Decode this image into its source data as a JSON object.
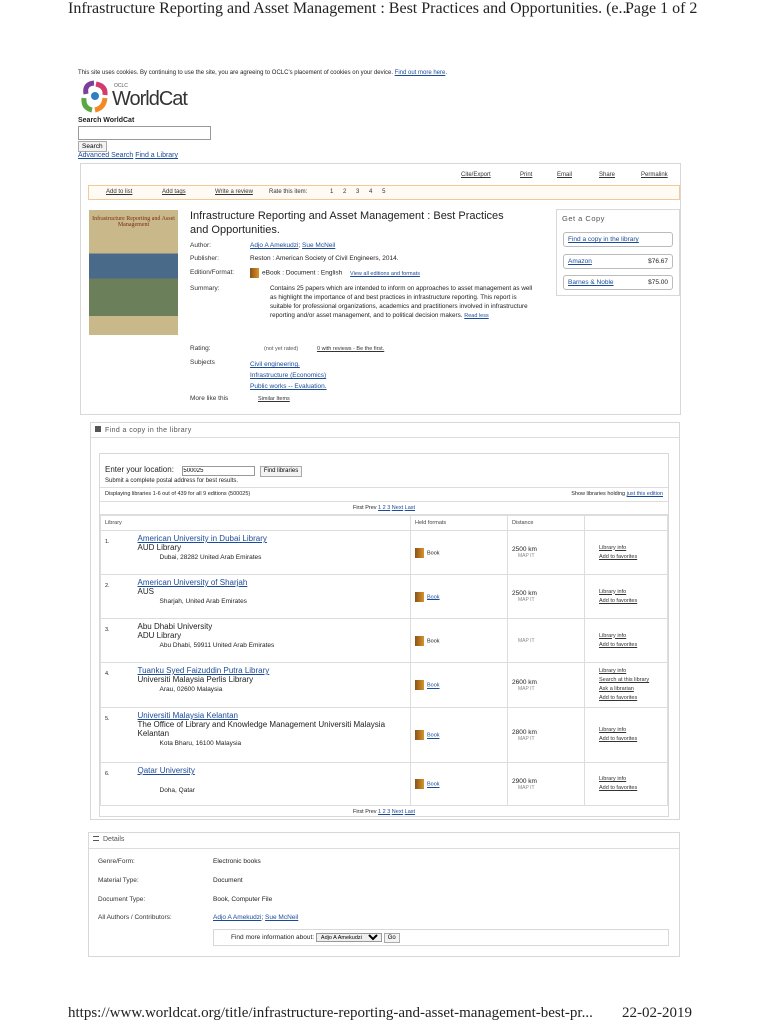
{
  "print_header": {
    "title": "Infrastructure Reporting and Asset Management : Best Practices and Opportunities. (e...",
    "page": "Page 1 of 2"
  },
  "cookie": {
    "text": "This site uses cookies. By continuing to use the site, you are agreeing to OCLC's placement of cookies on your device.",
    "link": "Find out more here",
    "end": "."
  },
  "logo": {
    "brand": "WorldCat",
    "sub": "OCLC"
  },
  "search": {
    "label": "Search WorldCat",
    "value": "",
    "button": "Search",
    "advanced": "Advanced Search",
    "find_library": "Find a Library"
  },
  "toolbar": {
    "cite": "Cite/Export",
    "print": "Print",
    "email": "Email",
    "share": "Share",
    "permalink": "Permalink"
  },
  "actions": {
    "add_list": "Add to list",
    "add_tags": "Add tags",
    "review": "Write a review",
    "rate": "Rate this item:",
    "ratings": [
      "1",
      "2",
      "3",
      "4",
      "5"
    ]
  },
  "record": {
    "cover_title": "Infrastructure Reporting and Asset Management",
    "title": "Infrastructure Reporting and Asset Management : Best Practices and Opportunities.",
    "author_label": "Author:",
    "authors": [
      "Adjo A Amekudzi",
      "Sue McNeil"
    ],
    "publisher_label": "Publisher:",
    "publisher": "Reston : American Society of Civil Engineers, 2014.",
    "edition_label": "Edition/Format:",
    "edition": "eBook : Document : English",
    "view_editions": "View all editions and formats",
    "summary_label": "Summary:",
    "summary": "Contains 25 papers which are intended to inform on approaches to asset management as well as highlight the importance of and best practices in infrastructure reporting. This report is suitable for professional organizations, academics and practitioners involved in infrastructure reporting and/or asset management, and to political decision makers.",
    "read_less": "Read less",
    "rating_label": "Rating:",
    "rating": "(not yet rated)",
    "reviews": "0 with reviews - Be the first.",
    "subjects_label": "Subjects",
    "subjects": [
      "Civil engineering.",
      "Infrastructure (Economics)",
      "Public works -- Evaluation."
    ],
    "more_label": "More like this",
    "similar": "Similar Items"
  },
  "get_copy": {
    "title": "Get a Copy",
    "find": "Find a copy in the library",
    "sellers": [
      {
        "name": "Amazon",
        "price": "$76.67"
      },
      {
        "name": "Barnes & Noble",
        "price": "$75.00"
      }
    ]
  },
  "find_copy": {
    "title": "Find a copy in the library",
    "location_label": "Enter your location:",
    "location": "500025",
    "find_btn": "Find libraries",
    "hint": "Submit a complete postal address for best results.",
    "displaying": "Displaying libraries 1-6 out of 439 for all 9 editions (500025)",
    "show_holding": "Show libraries holding",
    "just_edition": "just this edition",
    "pager": {
      "first": "First",
      "prev": "Prev",
      "pages": "1 2 3",
      "next": "Next",
      "last": "Last"
    },
    "columns": [
      "Library",
      "Held formats",
      "Distance",
      ""
    ],
    "rows": [
      {
        "n": "1.",
        "name": "American University in Dubai Library",
        "linked": true,
        "sub": "AUD Library",
        "addr": "Dubai, 28282 United Arab Emirates",
        "format": "Book",
        "dist": "2500 km",
        "map": "MAP IT",
        "acts": [
          "Library info",
          "Add to favorites"
        ]
      },
      {
        "n": "2.",
        "name": "American University of Sharjah",
        "linked": true,
        "sub": "AUS",
        "addr": "Sharjah, United Arab Emirates",
        "format": "Book",
        "dist": "2500 km",
        "map": "MAP IT",
        "acts": [
          "Library info",
          "Add to favorites"
        ]
      },
      {
        "n": "3.",
        "name": "Abu Dhabi University",
        "linked": false,
        "sub": "ADU Library",
        "addr": "Abu Dhabi, 59911 United Arab Emirates",
        "format": "Book",
        "dist": "",
        "map": "MAP IT",
        "acts": [
          "Library info",
          "Add to favorites"
        ]
      },
      {
        "n": "4.",
        "name": "Tuanku Syed Faizuddin Putra Library",
        "linked": true,
        "sub": "Universiti Malaysia Perlis Library",
        "addr": "Arau, 02600 Malaysia",
        "format": "Book",
        "dist": "2600 km",
        "map": "MAP IT",
        "acts": [
          "Library info",
          "Search at this library",
          "Ask a librarian",
          "Add to favorites"
        ]
      },
      {
        "n": "5.",
        "name": "Universiti Malaysia Kelantan",
        "linked": true,
        "sub": "The Office of Library and Knowledge Management Universiti Malaysia Kelantan",
        "addr": "Kota Bharu, 16100 Malaysia",
        "format": "Book",
        "dist": "2800 km",
        "map": "MAP IT",
        "acts": [
          "Library info",
          "Add to favorites"
        ]
      },
      {
        "n": "6.",
        "name": "Qatar University",
        "linked": true,
        "sub": "",
        "addr": "Doha, Qatar",
        "format": "Book",
        "dist": "2900 km",
        "map": "MAP IT",
        "acts": [
          "Library info",
          "Add to favorites"
        ]
      }
    ]
  },
  "details": {
    "title": "Details",
    "rows": [
      {
        "label": "Genre/Form:",
        "value": "Electronic books"
      },
      {
        "label": "Material Type:",
        "value": "Document"
      },
      {
        "label": "Document Type:",
        "value": "Book, Computer File"
      }
    ],
    "authors_label": "All Authors / Contributors:",
    "find_more": "Find more information about:",
    "find_value": "Adjo A Amekudzi",
    "go": "Go"
  },
  "print_footer": {
    "url": "https://www.worldcat.org/title/infrastructure-reporting-and-asset-management-best-pr...",
    "date": "22-02-2019"
  }
}
